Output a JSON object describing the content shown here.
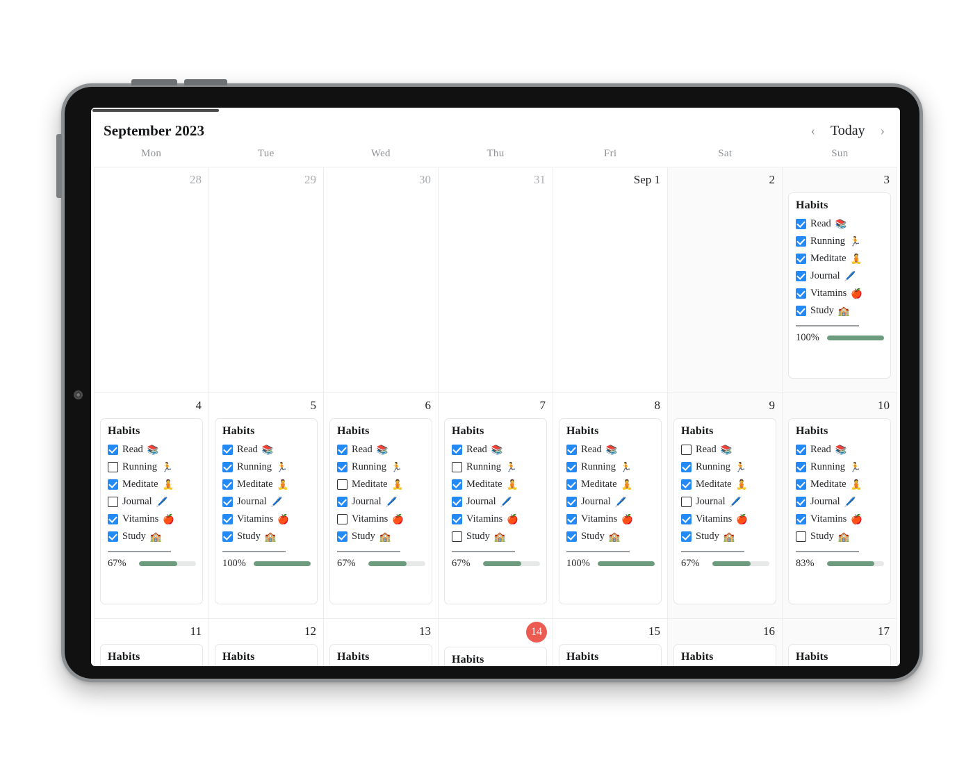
{
  "device": {
    "type": "tablet",
    "orientation": "landscape"
  },
  "header": {
    "month_title": "September 2023",
    "prev_label": "‹",
    "today_label": "Today",
    "next_label": "›"
  },
  "weekdays": [
    "Mon",
    "Tue",
    "Wed",
    "Thu",
    "Fri",
    "Sat",
    "Sun"
  ],
  "habit_names": [
    "Read",
    "Running",
    "Meditate",
    "Journal",
    "Vitamins",
    "Study"
  ],
  "habit_emojis": [
    "📚",
    "🏃",
    "🧘",
    "🖊️",
    "🍎",
    "🏫"
  ],
  "card_title": "Habits",
  "today": 14,
  "colors": {
    "checkbox_on": "#2389f4",
    "progress_fill": "#6d9b7d",
    "progress_track": "#e7e8e8",
    "today_badge": "#ec5b52",
    "weekend_bg": "#fafafa"
  },
  "weeks": [
    {
      "days": [
        {
          "num": "28",
          "muted": true,
          "weekend": false,
          "card": null
        },
        {
          "num": "29",
          "muted": true,
          "weekend": false,
          "card": null
        },
        {
          "num": "30",
          "muted": true,
          "weekend": false,
          "card": null
        },
        {
          "num": "31",
          "muted": true,
          "weekend": false,
          "card": null
        },
        {
          "num": "Sep 1",
          "muted": false,
          "weekend": false,
          "card": null
        },
        {
          "num": "2",
          "muted": false,
          "weekend": true,
          "card": null
        },
        {
          "num": "3",
          "muted": false,
          "weekend": true,
          "card": {
            "title": "Habits",
            "checks": [
              true,
              true,
              true,
              true,
              true,
              true
            ],
            "percent": "100%",
            "percent_value": 100
          }
        }
      ]
    },
    {
      "days": [
        {
          "num": "4",
          "muted": false,
          "weekend": false,
          "card": {
            "title": "Habits",
            "checks": [
              true,
              false,
              true,
              false,
              true,
              true
            ],
            "percent": "67%",
            "percent_value": 67
          }
        },
        {
          "num": "5",
          "muted": false,
          "weekend": false,
          "card": {
            "title": "Habits",
            "checks": [
              true,
              true,
              true,
              true,
              true,
              true
            ],
            "percent": "100%",
            "percent_value": 100
          }
        },
        {
          "num": "6",
          "muted": false,
          "weekend": false,
          "card": {
            "title": "Habits",
            "checks": [
              true,
              true,
              false,
              true,
              false,
              true
            ],
            "percent": "67%",
            "percent_value": 67
          }
        },
        {
          "num": "7",
          "muted": false,
          "weekend": false,
          "card": {
            "title": "Habits",
            "checks": [
              true,
              false,
              true,
              true,
              true,
              false
            ],
            "percent": "67%",
            "percent_value": 67
          }
        },
        {
          "num": "8",
          "muted": false,
          "weekend": false,
          "card": {
            "title": "Habits",
            "checks": [
              true,
              true,
              true,
              true,
              true,
              true
            ],
            "percent": "100%",
            "percent_value": 100
          }
        },
        {
          "num": "9",
          "muted": false,
          "weekend": true,
          "card": {
            "title": "Habits",
            "checks": [
              false,
              true,
              true,
              false,
              true,
              true
            ],
            "percent": "67%",
            "percent_value": 67
          }
        },
        {
          "num": "10",
          "muted": false,
          "weekend": true,
          "card": {
            "title": "Habits",
            "checks": [
              true,
              true,
              true,
              true,
              true,
              false
            ],
            "percent": "83%",
            "percent_value": 83
          }
        }
      ]
    },
    {
      "days": [
        {
          "num": "11",
          "muted": false,
          "weekend": false,
          "is_today": false,
          "card": {
            "title": "Habits",
            "clipped": true
          }
        },
        {
          "num": "12",
          "muted": false,
          "weekend": false,
          "is_today": false,
          "card": {
            "title": "Habits",
            "clipped": true
          }
        },
        {
          "num": "13",
          "muted": false,
          "weekend": false,
          "is_today": false,
          "card": {
            "title": "Habits",
            "clipped": true
          }
        },
        {
          "num": "14",
          "muted": false,
          "weekend": false,
          "is_today": true,
          "card": {
            "title": "Habits",
            "clipped": true
          }
        },
        {
          "num": "15",
          "muted": false,
          "weekend": false,
          "is_today": false,
          "card": {
            "title": "Habits",
            "clipped": true
          }
        },
        {
          "num": "16",
          "muted": false,
          "weekend": true,
          "is_today": false,
          "card": {
            "title": "Habits",
            "clipped": true
          }
        },
        {
          "num": "17",
          "muted": false,
          "weekend": true,
          "is_today": false,
          "card": {
            "title": "Habits",
            "clipped": true
          }
        }
      ]
    }
  ]
}
